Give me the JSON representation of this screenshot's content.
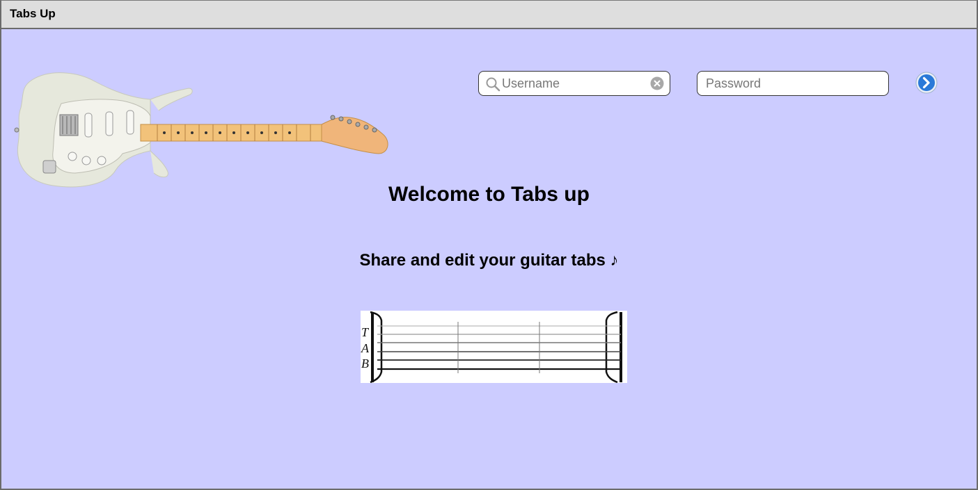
{
  "window": {
    "title": "Tabs Up"
  },
  "login": {
    "username_placeholder": "Username",
    "password_placeholder": "Password",
    "submit_icon": "arrow-right-circle-icon"
  },
  "main": {
    "heading": "Welcome to Tabs up",
    "subheading": "Share and edit your guitar tabs ♪",
    "tab_letters": [
      "T",
      "A",
      "B"
    ]
  },
  "colors": {
    "background": "#ccccff",
    "titlebar": "#dedede",
    "accent": "#2a79d8"
  }
}
